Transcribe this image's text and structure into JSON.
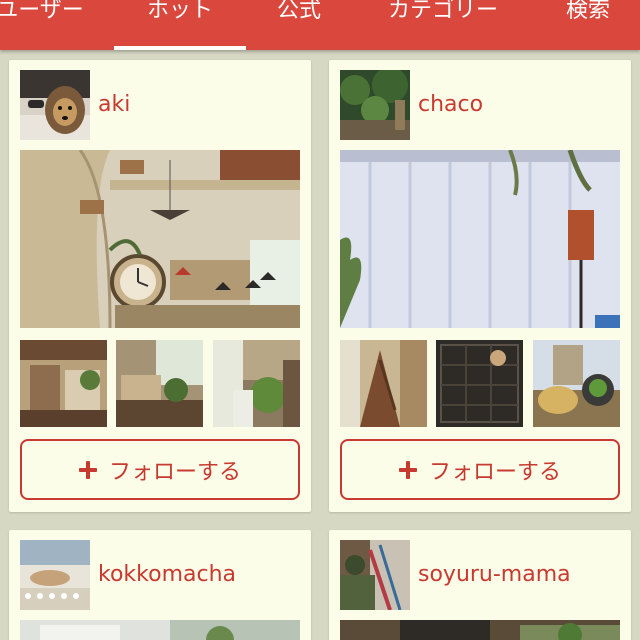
{
  "tabs": [
    {
      "label": "ユーザー",
      "active": false
    },
    {
      "label": "ホット",
      "active": true
    },
    {
      "label": "公式",
      "active": false
    },
    {
      "label": "カテゴリー",
      "active": false
    },
    {
      "label": "検索",
      "active": false
    }
  ],
  "colors": {
    "brand": "#d9473d",
    "accent_text": "#c8392f",
    "card_bg": "#fbfde9",
    "page_bg": "#d6d8c4"
  },
  "follow_label": "フォローする",
  "cards": [
    {
      "username": "aki"
    },
    {
      "username": "chaco"
    },
    {
      "username": "kokkomacha"
    },
    {
      "username": "soyuru-mama"
    }
  ]
}
